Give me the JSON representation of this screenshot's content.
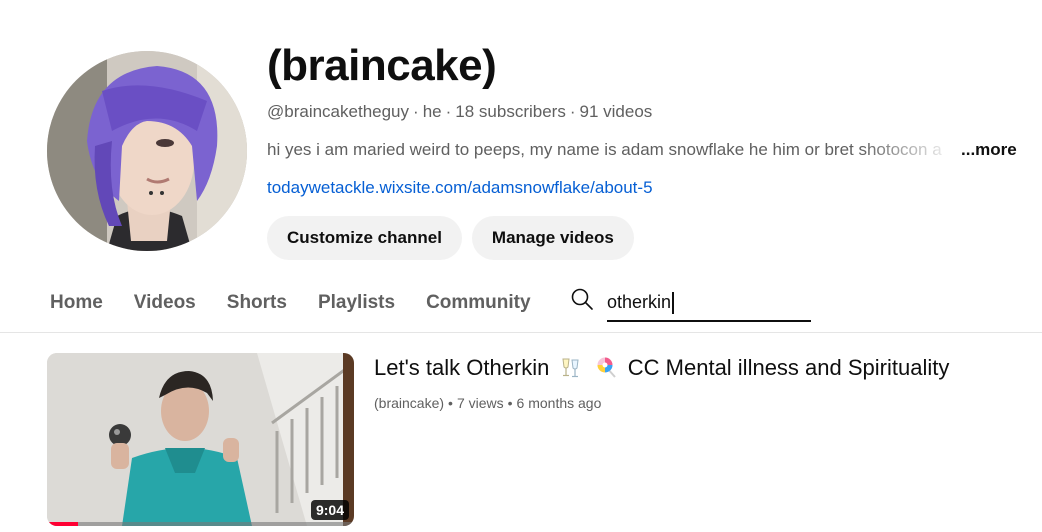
{
  "channel": {
    "title": "(braincake)",
    "handle": "@braincaketheguy",
    "pronoun": "he",
    "subscribers": "18 subscribers",
    "videos": "91 videos",
    "meta_separator": "·",
    "description": "hi yes i am maried weird to peeps, my name is adam snowflake he him or bret shotocon a",
    "more_label": "...more",
    "link": "todaywetackle.wixsite.com/adamsnowflake/about-5",
    "customize_label": "Customize channel",
    "manage_label": "Manage videos"
  },
  "tabs": [
    {
      "label": "Home"
    },
    {
      "label": "Videos"
    },
    {
      "label": "Shorts"
    },
    {
      "label": "Playlists"
    },
    {
      "label": "Community"
    }
  ],
  "search": {
    "value": "otherkin",
    "icon": "search-icon"
  },
  "results": [
    {
      "title_part1": "Let's talk Otherkin",
      "title_part2": "CC Mental illness and Spirituality",
      "title_emojis": [
        "clinking-glasses-icon",
        "lollipop-icon"
      ],
      "channel": "(braincake)",
      "views": "7 views",
      "age": "6 months ago",
      "separator": "•",
      "duration": "9:04",
      "watched_fraction": 0.1
    }
  ],
  "colors": {
    "link": "#065fd4",
    "secondary_text": "#606060",
    "pill_bg": "#f2f2f2",
    "progress": "#ff0033",
    "avatar_hair": "#7b63d0"
  }
}
